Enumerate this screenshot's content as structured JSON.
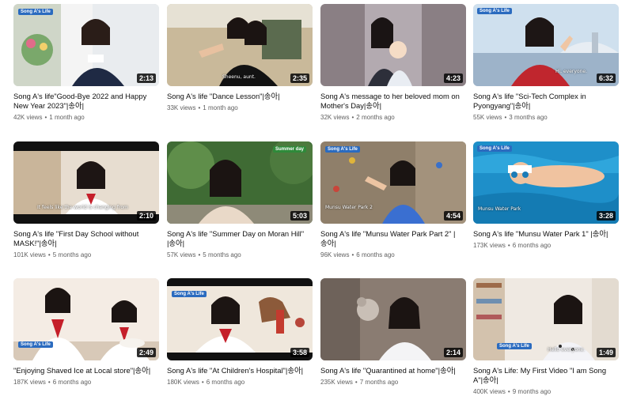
{
  "videos": [
    {
      "title": "Song A's life\"Good-Bye 2022 and Happy New Year 2023\"|송아|",
      "views": "42K views",
      "age": "1 month ago",
      "duration": "2:13",
      "overlay": ""
    },
    {
      "title": "Song A's life \"Dance Lesson\"|송아|",
      "views": "33K views",
      "age": "1 month ago",
      "duration": "2:35",
      "overlay": "Sheenu, aunt."
    },
    {
      "title": "Song A's message to her beloved mom on Mother's Day|송아|",
      "views": "32K views",
      "age": "2 months ago",
      "duration": "4:23",
      "overlay": ""
    },
    {
      "title": "Song A's life \"Sci-Tech Complex in Pyongyang\"|송아|",
      "views": "55K views",
      "age": "3 months ago",
      "duration": "6:32",
      "overlay": "Hi, everyone."
    },
    {
      "title": "Song A's life \"First Day School without MASK!\"|송아|",
      "views": "101K views",
      "age": "5 months ago",
      "duration": "2:10",
      "overlay": "It feels like the world is changing from"
    },
    {
      "title": "Song A's life \"Summer Day on Moran Hill\" |송아|",
      "views": "57K views",
      "age": "5 months ago",
      "duration": "5:03",
      "overlay": "Summer day"
    },
    {
      "title": "Song A's life \"Munsu Water Park Part 2\" |송아|",
      "views": "96K views",
      "age": "6 months ago",
      "duration": "4:54",
      "overlay": "Munsu Water Park 2"
    },
    {
      "title": "Song A's life \"Munsu Water Park 1\" |송아|",
      "views": "173K views",
      "age": "6 months ago",
      "duration": "3:28",
      "overlay": "Munsu Water Park"
    },
    {
      "title": "\"Enjoying Shaved Ice at Local store\"|송아|",
      "views": "187K views",
      "age": "6 months ago",
      "duration": "2:49",
      "overlay": ""
    },
    {
      "title": "Song A's life \"At Children's Hospital\"|송아|",
      "views": "180K views",
      "age": "6 months ago",
      "duration": "3:58",
      "overlay": ""
    },
    {
      "title": "Song A's life \"Quarantined at home\"|송아|",
      "views": "235K views",
      "age": "7 months ago",
      "duration": "2:14",
      "overlay": ""
    },
    {
      "title": "Song A's Life: My First Video \"I am Song A\"|송아|",
      "views": "400K views",
      "age": "9 months ago",
      "duration": "1:49",
      "overlay": "Hello everyone."
    }
  ],
  "brand": "Song A's Life",
  "colors": {
    "duration_bg": "#000000",
    "meta": "#606060",
    "title": "#0f0f0f"
  }
}
